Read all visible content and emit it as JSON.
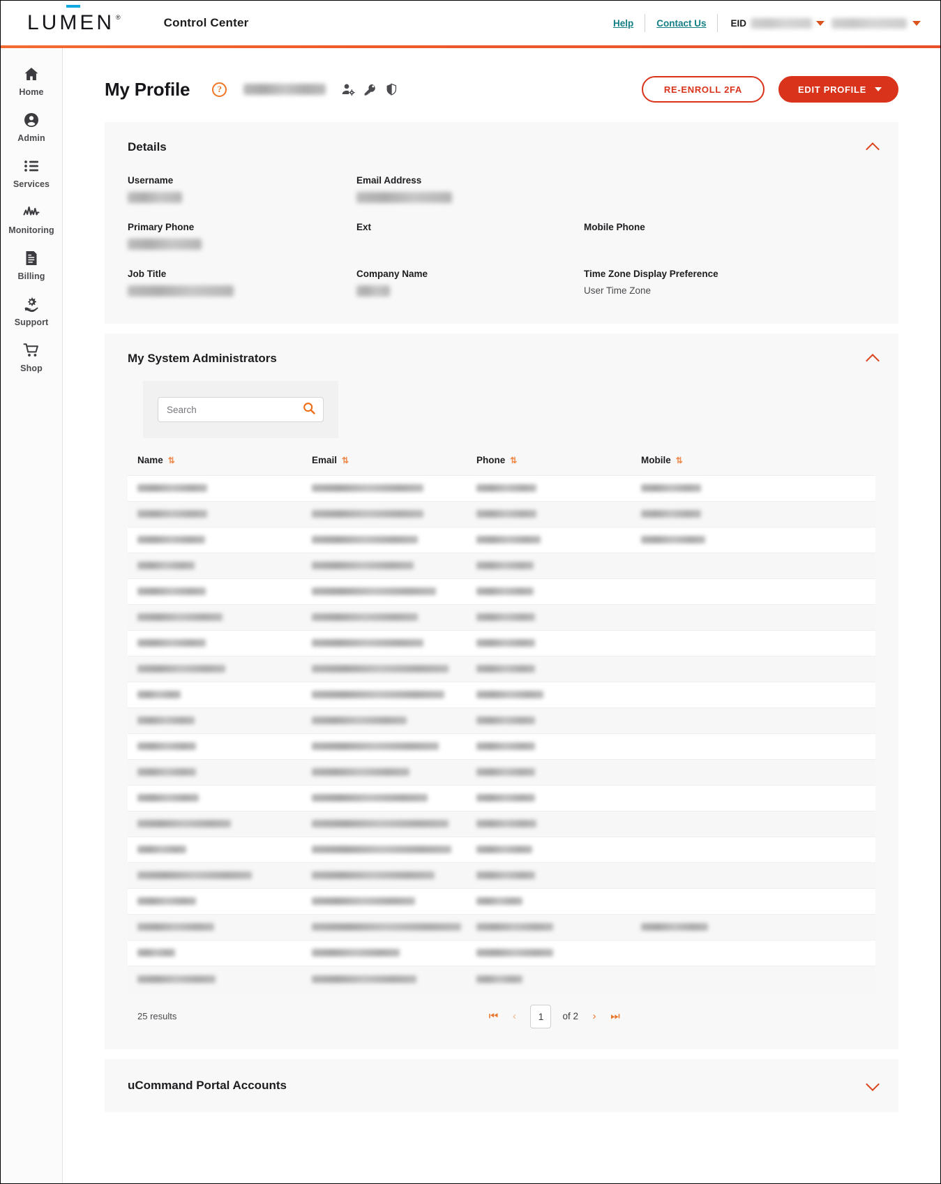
{
  "header": {
    "logo_text": "LUMEN",
    "logo_registered": "®",
    "app_title": "Control Center",
    "help_label": "Help",
    "contact_label": "Contact Us",
    "eid_label": "EID",
    "eid_value_redacted": true,
    "account_value_redacted": true,
    "accent_color": "#ee5a2a"
  },
  "sidebar": {
    "items": [
      {
        "label": "Home",
        "icon": "home-icon"
      },
      {
        "label": "Admin",
        "icon": "user-circle-icon"
      },
      {
        "label": "Services",
        "icon": "list-icon"
      },
      {
        "label": "Monitoring",
        "icon": "pulse-icon"
      },
      {
        "label": "Billing",
        "icon": "invoice-icon"
      },
      {
        "label": "Support",
        "icon": "gear-hand-icon"
      },
      {
        "label": "Shop",
        "icon": "cart-icon"
      }
    ]
  },
  "page": {
    "title": "My Profile",
    "help_glyph": "?",
    "user_name_redacted": true,
    "title_icons": [
      "user-settings-icon",
      "key-icon",
      "shield-icon"
    ],
    "buttons": {
      "reenroll_2fa": "RE-ENROLL 2FA",
      "edit_profile": "EDIT PROFILE"
    }
  },
  "details": {
    "title": "Details",
    "expanded": true,
    "fields": [
      {
        "label": "Username",
        "value": "",
        "redacted": true,
        "blur_width": 78
      },
      {
        "label": "Email Address",
        "value": "",
        "redacted": true,
        "blur_width": 137
      },
      {
        "label": "",
        "value": "",
        "redacted": false,
        "blur_width": 0
      },
      {
        "label": "Primary Phone",
        "value": "",
        "redacted": true,
        "blur_width": 106
      },
      {
        "label": "Ext",
        "value": "",
        "redacted": false,
        "blur_width": 0
      },
      {
        "label": "Mobile Phone",
        "value": "",
        "redacted": false,
        "blur_width": 0
      },
      {
        "label": "Job Title",
        "value": "",
        "redacted": true,
        "blur_width": 152
      },
      {
        "label": "Company Name",
        "value": "",
        "redacted": true,
        "blur_width": 48
      },
      {
        "label": "Time Zone Display Preference",
        "value": "User Time Zone",
        "redacted": false,
        "blur_width": 0
      }
    ]
  },
  "admins": {
    "title": "My System Administrators",
    "expanded": true,
    "search": {
      "placeholder": "Search",
      "value": "",
      "icon": "search-icon"
    },
    "columns": [
      {
        "label": "Name",
        "sort_icon": "⇅"
      },
      {
        "label": "Email",
        "sort_icon": "⇅"
      },
      {
        "label": "Phone",
        "sort_icon": "⇅"
      },
      {
        "label": "Mobile",
        "sort_icon": "⇅"
      }
    ],
    "rows": [
      {
        "name_w": 100,
        "email_w": 160,
        "phone_w": 86,
        "mobile_w": 86
      },
      {
        "name_w": 100,
        "email_w": 160,
        "phone_w": 86,
        "mobile_w": 86
      },
      {
        "name_w": 97,
        "email_w": 152,
        "phone_w": 92,
        "mobile_w": 92
      },
      {
        "name_w": 82,
        "email_w": 146,
        "phone_w": 82,
        "mobile_w": 0
      },
      {
        "name_w": 98,
        "email_w": 178,
        "phone_w": 82,
        "mobile_w": 0
      },
      {
        "name_w": 122,
        "email_w": 152,
        "phone_w": 84,
        "mobile_w": 0
      },
      {
        "name_w": 98,
        "email_w": 160,
        "phone_w": 84,
        "mobile_w": 0
      },
      {
        "name_w": 126,
        "email_w": 196,
        "phone_w": 84,
        "mobile_w": 0
      },
      {
        "name_w": 62,
        "email_w": 190,
        "phone_w": 96,
        "mobile_w": 0
      },
      {
        "name_w": 82,
        "email_w": 136,
        "phone_w": 84,
        "mobile_w": 0
      },
      {
        "name_w": 84,
        "email_w": 182,
        "phone_w": 84,
        "mobile_w": 0
      },
      {
        "name_w": 84,
        "email_w": 140,
        "phone_w": 84,
        "mobile_w": 0
      },
      {
        "name_w": 88,
        "email_w": 166,
        "phone_w": 84,
        "mobile_w": 0
      },
      {
        "name_w": 134,
        "email_w": 196,
        "phone_w": 86,
        "mobile_w": 0
      },
      {
        "name_w": 70,
        "email_w": 200,
        "phone_w": 80,
        "mobile_w": 0
      },
      {
        "name_w": 164,
        "email_w": 176,
        "phone_w": 84,
        "mobile_w": 0
      },
      {
        "name_w": 84,
        "email_w": 148,
        "phone_w": 66,
        "mobile_w": 0
      },
      {
        "name_w": 110,
        "email_w": 214,
        "phone_w": 110,
        "mobile_w": 96
      },
      {
        "name_w": 54,
        "email_w": 126,
        "phone_w": 110,
        "mobile_w": 0
      },
      {
        "name_w": 112,
        "email_w": 150,
        "phone_w": 66,
        "mobile_w": 0
      }
    ],
    "footer": {
      "results_text": "25 results",
      "first_icon": "⏮",
      "prev_icon": "‹",
      "page_value": "1",
      "of_text": "of 2",
      "next_icon": "›",
      "last_icon": "⏭"
    }
  },
  "ucommand": {
    "title": "uCommand Portal Accounts",
    "expanded": false
  }
}
